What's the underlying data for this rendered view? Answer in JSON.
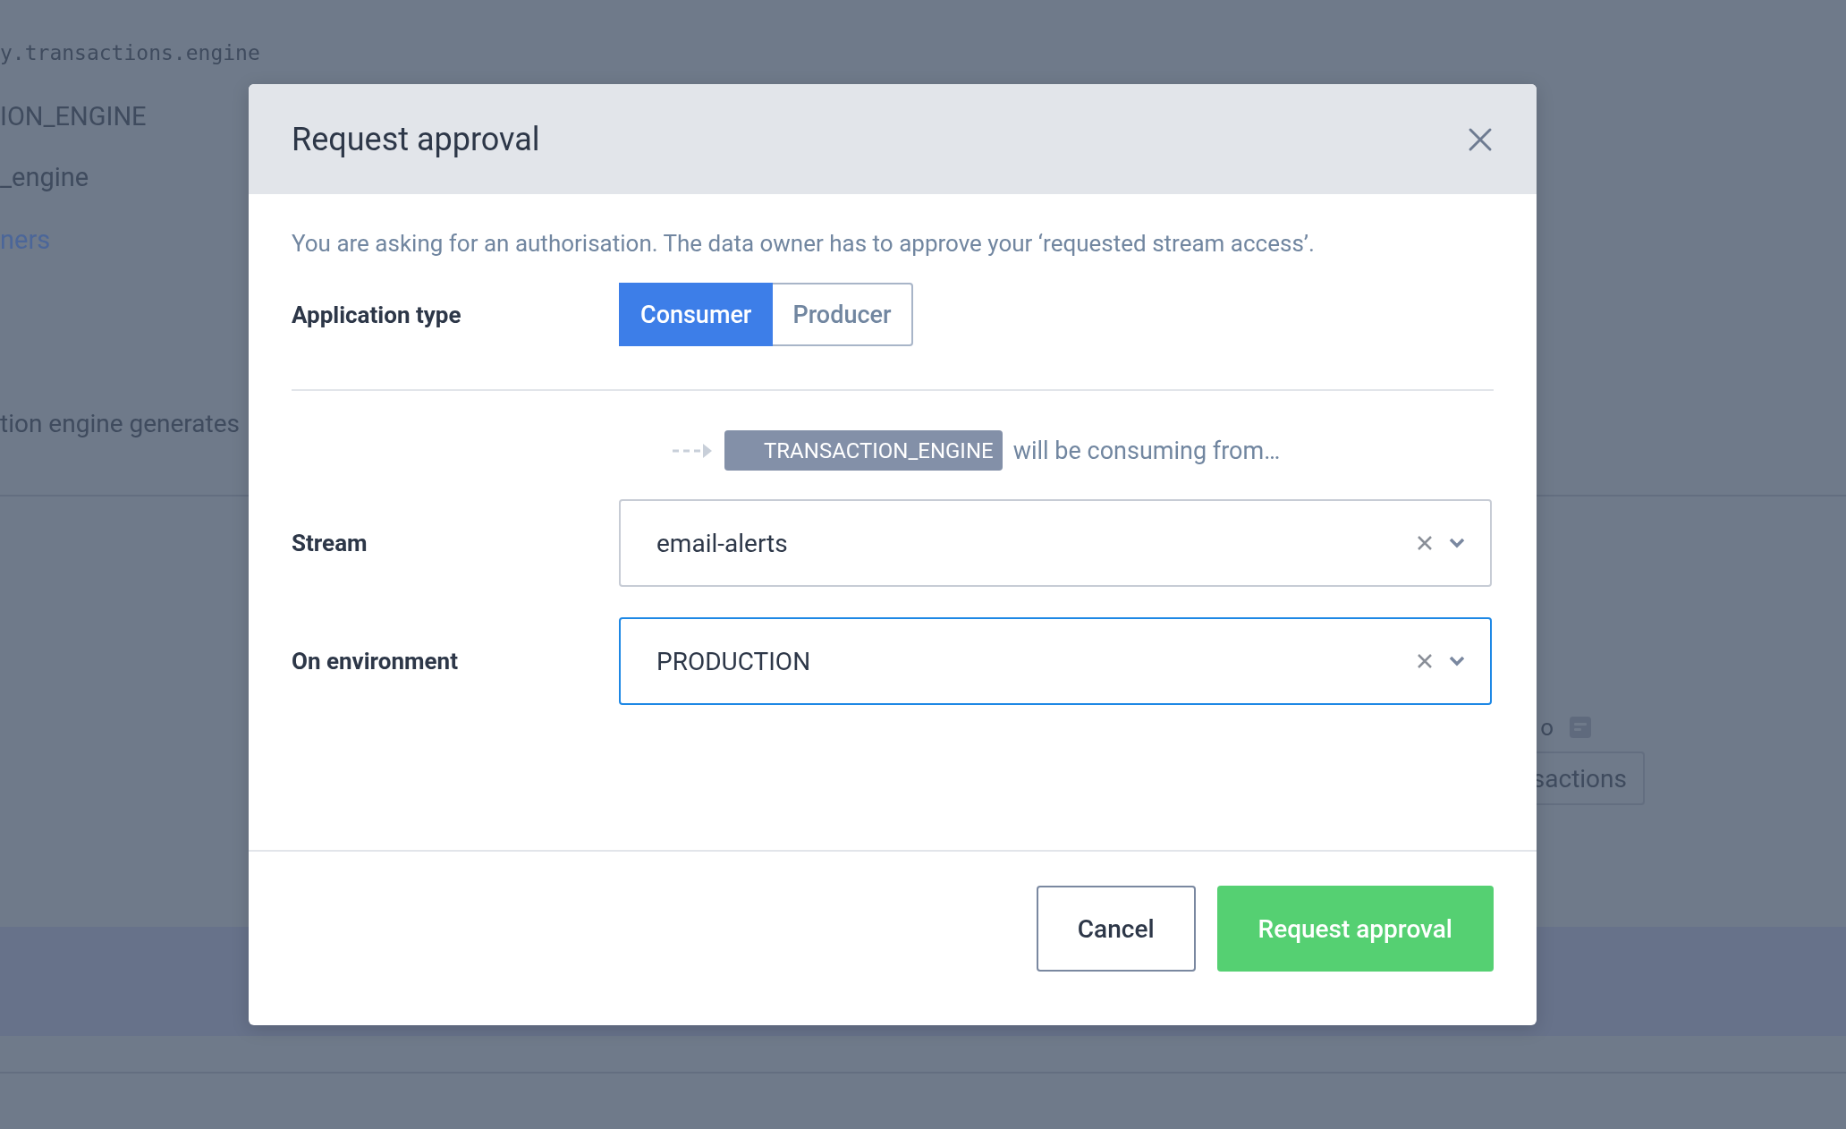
{
  "background": {
    "code_line": "y.transactions.engine",
    "name_line": "ION_ENGINE",
    "id_line": "_engine",
    "owners_link": "ners",
    "description": "tion engine generates",
    "info_text": "o",
    "topics_button": "sactions"
  },
  "dialog": {
    "title": "Request approval",
    "intro": "You are asking for an authorisation. The data owner has to approve your ‘requested stream access’.",
    "application_type": {
      "label": "Application type",
      "options": [
        {
          "label": "Consumer",
          "selected": true
        },
        {
          "label": "Producer",
          "selected": false
        }
      ]
    },
    "flow": {
      "application": "TRANSACTION_ENGINE",
      "text": "will be consuming from…"
    },
    "fields": [
      {
        "label": "Stream",
        "value": "email-alerts",
        "focused": false
      },
      {
        "label": "On environment",
        "value": "PRODUCTION",
        "focused": true
      }
    ],
    "buttons": [
      {
        "label": "Cancel",
        "kind": "secondary"
      },
      {
        "label": "Request approval",
        "kind": "primary"
      }
    ]
  }
}
